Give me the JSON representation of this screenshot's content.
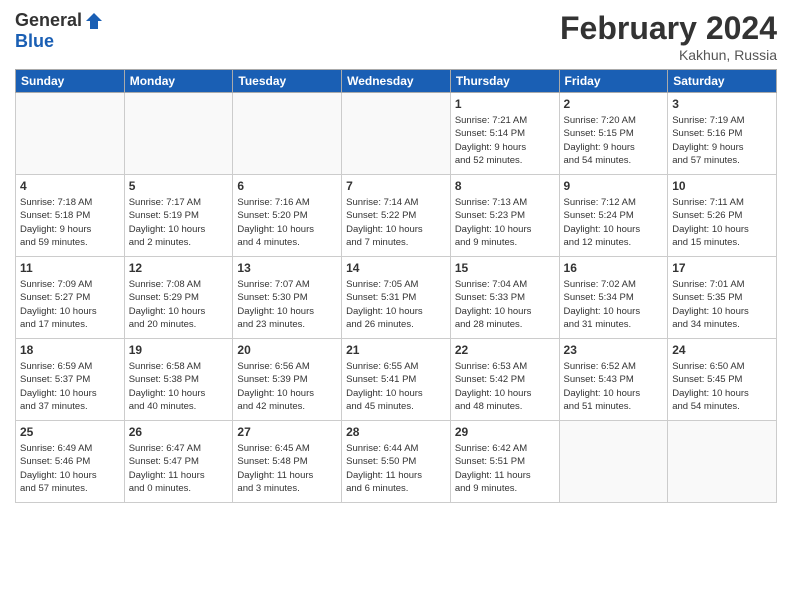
{
  "header": {
    "logo_general": "General",
    "logo_blue": "Blue",
    "month_title": "February 2024",
    "location": "Kakhun, Russia"
  },
  "days_of_week": [
    "Sunday",
    "Monday",
    "Tuesday",
    "Wednesday",
    "Thursday",
    "Friday",
    "Saturday"
  ],
  "weeks": [
    [
      {
        "day": "",
        "info": ""
      },
      {
        "day": "",
        "info": ""
      },
      {
        "day": "",
        "info": ""
      },
      {
        "day": "",
        "info": ""
      },
      {
        "day": "1",
        "info": "Sunrise: 7:21 AM\nSunset: 5:14 PM\nDaylight: 9 hours\nand 52 minutes."
      },
      {
        "day": "2",
        "info": "Sunrise: 7:20 AM\nSunset: 5:15 PM\nDaylight: 9 hours\nand 54 minutes."
      },
      {
        "day": "3",
        "info": "Sunrise: 7:19 AM\nSunset: 5:16 PM\nDaylight: 9 hours\nand 57 minutes."
      }
    ],
    [
      {
        "day": "4",
        "info": "Sunrise: 7:18 AM\nSunset: 5:18 PM\nDaylight: 9 hours\nand 59 minutes."
      },
      {
        "day": "5",
        "info": "Sunrise: 7:17 AM\nSunset: 5:19 PM\nDaylight: 10 hours\nand 2 minutes."
      },
      {
        "day": "6",
        "info": "Sunrise: 7:16 AM\nSunset: 5:20 PM\nDaylight: 10 hours\nand 4 minutes."
      },
      {
        "day": "7",
        "info": "Sunrise: 7:14 AM\nSunset: 5:22 PM\nDaylight: 10 hours\nand 7 minutes."
      },
      {
        "day": "8",
        "info": "Sunrise: 7:13 AM\nSunset: 5:23 PM\nDaylight: 10 hours\nand 9 minutes."
      },
      {
        "day": "9",
        "info": "Sunrise: 7:12 AM\nSunset: 5:24 PM\nDaylight: 10 hours\nand 12 minutes."
      },
      {
        "day": "10",
        "info": "Sunrise: 7:11 AM\nSunset: 5:26 PM\nDaylight: 10 hours\nand 15 minutes."
      }
    ],
    [
      {
        "day": "11",
        "info": "Sunrise: 7:09 AM\nSunset: 5:27 PM\nDaylight: 10 hours\nand 17 minutes."
      },
      {
        "day": "12",
        "info": "Sunrise: 7:08 AM\nSunset: 5:29 PM\nDaylight: 10 hours\nand 20 minutes."
      },
      {
        "day": "13",
        "info": "Sunrise: 7:07 AM\nSunset: 5:30 PM\nDaylight: 10 hours\nand 23 minutes."
      },
      {
        "day": "14",
        "info": "Sunrise: 7:05 AM\nSunset: 5:31 PM\nDaylight: 10 hours\nand 26 minutes."
      },
      {
        "day": "15",
        "info": "Sunrise: 7:04 AM\nSunset: 5:33 PM\nDaylight: 10 hours\nand 28 minutes."
      },
      {
        "day": "16",
        "info": "Sunrise: 7:02 AM\nSunset: 5:34 PM\nDaylight: 10 hours\nand 31 minutes."
      },
      {
        "day": "17",
        "info": "Sunrise: 7:01 AM\nSunset: 5:35 PM\nDaylight: 10 hours\nand 34 minutes."
      }
    ],
    [
      {
        "day": "18",
        "info": "Sunrise: 6:59 AM\nSunset: 5:37 PM\nDaylight: 10 hours\nand 37 minutes."
      },
      {
        "day": "19",
        "info": "Sunrise: 6:58 AM\nSunset: 5:38 PM\nDaylight: 10 hours\nand 40 minutes."
      },
      {
        "day": "20",
        "info": "Sunrise: 6:56 AM\nSunset: 5:39 PM\nDaylight: 10 hours\nand 42 minutes."
      },
      {
        "day": "21",
        "info": "Sunrise: 6:55 AM\nSunset: 5:41 PM\nDaylight: 10 hours\nand 45 minutes."
      },
      {
        "day": "22",
        "info": "Sunrise: 6:53 AM\nSunset: 5:42 PM\nDaylight: 10 hours\nand 48 minutes."
      },
      {
        "day": "23",
        "info": "Sunrise: 6:52 AM\nSunset: 5:43 PM\nDaylight: 10 hours\nand 51 minutes."
      },
      {
        "day": "24",
        "info": "Sunrise: 6:50 AM\nSunset: 5:45 PM\nDaylight: 10 hours\nand 54 minutes."
      }
    ],
    [
      {
        "day": "25",
        "info": "Sunrise: 6:49 AM\nSunset: 5:46 PM\nDaylight: 10 hours\nand 57 minutes."
      },
      {
        "day": "26",
        "info": "Sunrise: 6:47 AM\nSunset: 5:47 PM\nDaylight: 11 hours\nand 0 minutes."
      },
      {
        "day": "27",
        "info": "Sunrise: 6:45 AM\nSunset: 5:48 PM\nDaylight: 11 hours\nand 3 minutes."
      },
      {
        "day": "28",
        "info": "Sunrise: 6:44 AM\nSunset: 5:50 PM\nDaylight: 11 hours\nand 6 minutes."
      },
      {
        "day": "29",
        "info": "Sunrise: 6:42 AM\nSunset: 5:51 PM\nDaylight: 11 hours\nand 9 minutes."
      },
      {
        "day": "",
        "info": ""
      },
      {
        "day": "",
        "info": ""
      }
    ]
  ]
}
